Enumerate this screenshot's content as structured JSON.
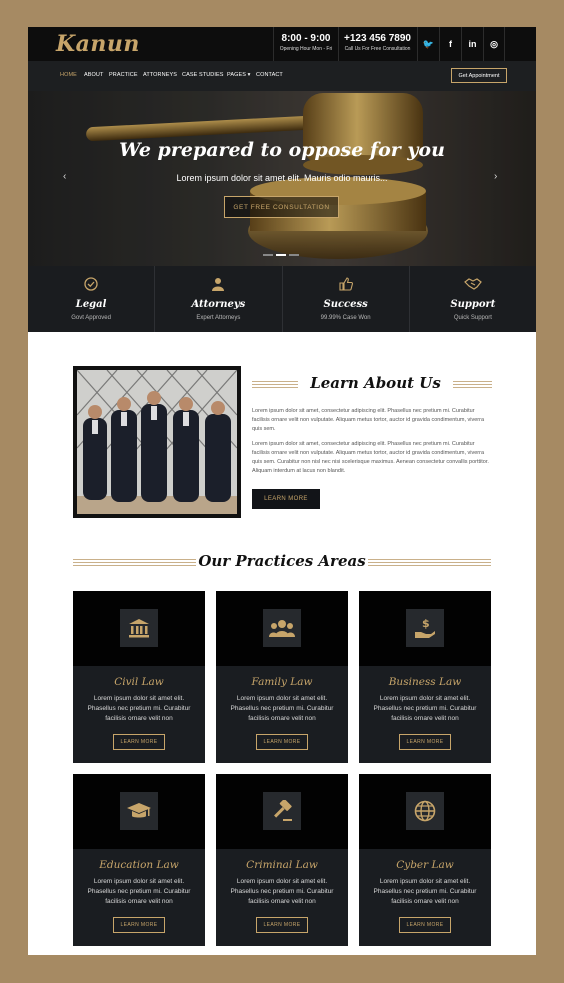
{
  "brand": {
    "logo": "Kanun"
  },
  "topbar": {
    "hours": "8:00 - 9:00",
    "hours_sub": "Opening Hour Mon - Fri",
    "phone": "+123 456 7890",
    "phone_sub": "Call Us For Free Consultation",
    "social": [
      {
        "icon": "twitter-icon",
        "glyph": "🐦"
      },
      {
        "icon": "facebook-icon",
        "glyph": "f"
      },
      {
        "icon": "linkedin-icon",
        "glyph": "in"
      },
      {
        "icon": "instagram-icon",
        "glyph": "◎"
      }
    ]
  },
  "nav": {
    "items": [
      "HOME",
      "ABOUT",
      "PRACTICE",
      "ATTORNEYS",
      "CASE STUDIES",
      "PAGES ▾",
      "CONTACT"
    ],
    "cta": "Get Appointment"
  },
  "hero": {
    "title": "We prepared to oppose for you",
    "subtitle": "Lorem ipsum dolor sit amet elit. Mauris odio mauris...",
    "button": "GET FREE CONSULTATION",
    "prev": "‹",
    "next": "›"
  },
  "features": [
    {
      "title": "Legal",
      "sub": "Govt Approved",
      "icon": "checkmark-circle-icon"
    },
    {
      "title": "Attorneys",
      "sub": "Expert Attorneys",
      "icon": "attorney-icon"
    },
    {
      "title": "Success",
      "sub": "99.99% Case Won",
      "icon": "thumbs-up-icon"
    },
    {
      "title": "Support",
      "sub": "Quick Support",
      "icon": "handshake-icon"
    }
  ],
  "about": {
    "title": "Learn About Us",
    "p1": "Lorem ipsum dolor sit amet, consectetur adipiscing elit. Phasellus nec pretium mi. Curabitur facilisis ornare velit non vulputate. Aliquam metus tortor, auctor id gravida condimentum, viverra quis sem.",
    "p2": "Lorem ipsum dolor sit amet, consectetur adipiscing elit. Phasellus nec pretium mi. Curabitur facilisis ornare velit non vulputate. Aliquam metus tortor, auctor id gravida condimentum, viverra quis sem. Curabitur non nisl nec nisi scelerisque maximus. Aenean consectetur convallis porttitor. Aliquam interdum at lacus non blandit.",
    "button": "LEARN MORE"
  },
  "practices": {
    "title": "Our Practices Areas",
    "cards": [
      {
        "title": "Civil Law",
        "text": "Lorem ipsum dolor sit amet elit. Phasellus nec pretium mi. Curabitur facilisis ornare velit non",
        "button": "LEARN MORE",
        "icon": "courthouse-icon"
      },
      {
        "title": "Family Law",
        "text": "Lorem ipsum dolor sit amet elit. Phasellus nec pretium mi. Curabitur facilisis ornare velit non",
        "button": "LEARN MORE",
        "icon": "family-icon"
      },
      {
        "title": "Business Law",
        "text": "Lorem ipsum dolor sit amet elit. Phasellus nec pretium mi. Curabitur facilisis ornare velit non",
        "button": "LEARN MORE",
        "icon": "hand-dollar-icon"
      },
      {
        "title": "Education Law",
        "text": "Lorem ipsum dolor sit amet elit. Phasellus nec pretium mi. Curabitur facilisis ornare velit non",
        "button": "LEARN MORE",
        "icon": "graduation-cap-icon"
      },
      {
        "title": "Criminal Law",
        "text": "Lorem ipsum dolor sit amet elit. Phasellus nec pretium mi. Curabitur facilisis ornare velit non",
        "button": "LEARN MORE",
        "icon": "gavel-icon"
      },
      {
        "title": "Cyber Law",
        "text": "Lorem ipsum dolor sit amet elit. Phasellus nec pretium mi. Curabitur facilisis ornare velit non",
        "button": "LEARN MORE",
        "icon": "globe-icon"
      }
    ]
  },
  "colors": {
    "accent": "#c7a56a",
    "dark": "#0d0d0d",
    "frame": "#a68a63"
  }
}
